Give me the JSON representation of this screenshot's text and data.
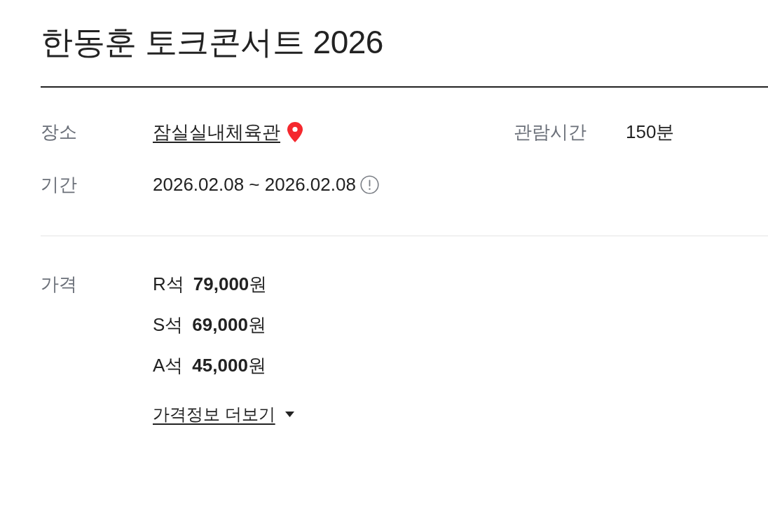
{
  "title": "한동훈 토크콘서트 2026",
  "info": {
    "rows": [
      {
        "items": [
          {
            "label": "장소",
            "value": "잠실실내체육관",
            "kind": "location"
          },
          {
            "label": "관람시간",
            "value": "150분",
            "kind": "plain"
          }
        ]
      },
      {
        "items": [
          {
            "label": "기간",
            "value": "2026.02.08 ~ 2026.02.08",
            "kind": "notice"
          }
        ]
      }
    ]
  },
  "price": {
    "label": "가격",
    "rows": [
      {
        "seat": "R석",
        "price": "**79,000**원"
      },
      {
        "seat": "S석",
        "price": "**69,000**원"
      },
      {
        "seat": "A석",
        "price": "**45,000**원"
      }
    ],
    "more_link": "가격정보 더보기"
  }
}
